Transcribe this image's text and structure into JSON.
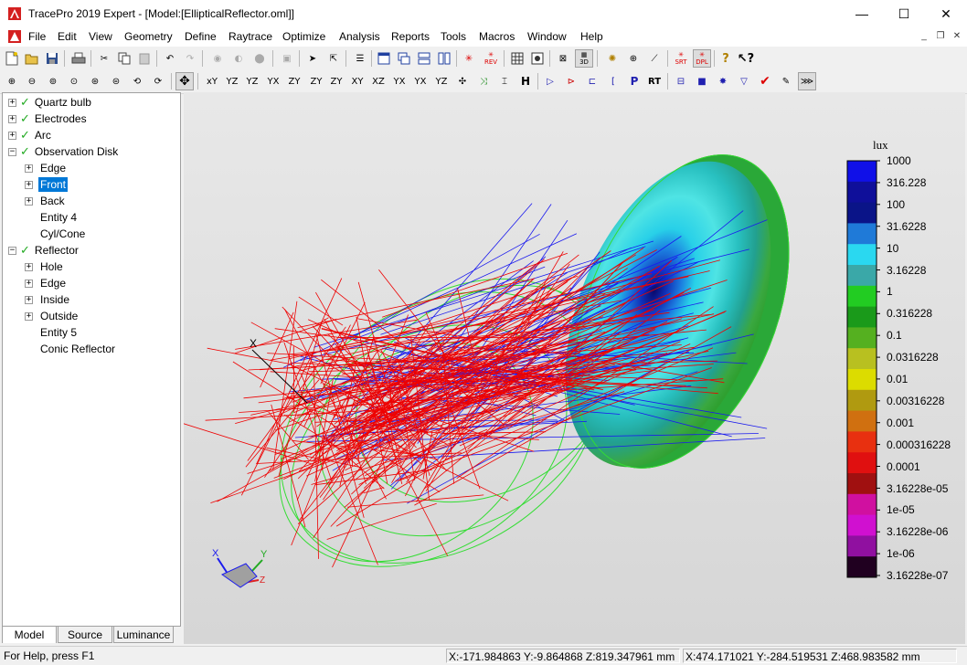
{
  "window": {
    "title": "TracePro 2019 Expert - [Model:[EllipticalReflector.oml]]",
    "minimize": "—",
    "maximize": "☐",
    "close": "✕"
  },
  "menu": [
    "File",
    "Edit",
    "View",
    "Geometry",
    "Define",
    "Raytrace",
    "Optimize",
    "Analysis",
    "Reports",
    "Tools",
    "Macros",
    "Window",
    "Help"
  ],
  "mdi": {
    "minimize": "_",
    "restore": "❐",
    "close": "✕"
  },
  "toolbar1": {
    "srt": "SRT",
    "rev": "REV",
    "dpl": "DPL",
    "mode_3d": "3D"
  },
  "toolbar2": {
    "view_labels": [
      "xY",
      "YZ",
      "YZ",
      "YX",
      "ZY",
      "ZY",
      "ZY",
      "XY",
      "XZ",
      "YX",
      "YX",
      "YZ"
    ],
    "p": "P",
    "rt": "RT",
    "h": "H"
  },
  "tree": [
    {
      "label": "Quartz bulb",
      "level": 0,
      "expander": "+",
      "check": true
    },
    {
      "label": "Electrodes",
      "level": 0,
      "expander": "+",
      "check": true
    },
    {
      "label": "Arc",
      "level": 0,
      "expander": "+",
      "check": true
    },
    {
      "label": "Observation Disk",
      "level": 0,
      "expander": "−",
      "check": true
    },
    {
      "label": "Edge",
      "level": 1,
      "expander": "+",
      "check": false
    },
    {
      "label": "Front",
      "level": 1,
      "expander": "+",
      "check": false,
      "selected": true
    },
    {
      "label": "Back",
      "level": 1,
      "expander": "+",
      "check": false
    },
    {
      "label": "Entity 4",
      "level": 1,
      "expander": "",
      "check": false
    },
    {
      "label": "Cyl/Cone",
      "level": 1,
      "expander": "",
      "check": false
    },
    {
      "label": "Reflector",
      "level": 0,
      "expander": "−",
      "check": true
    },
    {
      "label": "Hole",
      "level": 1,
      "expander": "+",
      "check": false
    },
    {
      "label": "Edge",
      "level": 1,
      "expander": "+",
      "check": false
    },
    {
      "label": "Inside",
      "level": 1,
      "expander": "+",
      "check": false
    },
    {
      "label": "Outside",
      "level": 1,
      "expander": "+",
      "check": false
    },
    {
      "label": "Entity 5",
      "level": 1,
      "expander": "",
      "check": false
    },
    {
      "label": "Conic Reflector",
      "level": 1,
      "expander": "",
      "check": false
    }
  ],
  "tabs": [
    "Model",
    "Source",
    "Luminance"
  ],
  "viewport": {
    "axis_label": "X",
    "triad": {
      "x": "X",
      "y": "Y",
      "z": "Z"
    },
    "legend": {
      "unit": "lux",
      "labels": [
        "1000",
        "316.228",
        "100",
        "31.6228",
        "10",
        "3.16228",
        "1",
        "0.316228",
        "0.1",
        "0.0316228",
        "0.01",
        "0.00316228",
        "0.001",
        "0.000316228",
        "0.0001",
        "3.16228e-05",
        "1e-05",
        "3.16228e-06",
        "1e-06",
        "3.16228e-07"
      ]
    }
  },
  "status": {
    "help": "For Help, press F1",
    "coord1": "X:-171.984863 Y:-9.864868 Z:819.347961 mm",
    "coord2": "X:474.171021 Y:-284.519531 Z:468.983582 mm"
  },
  "colors": {
    "ray_red": "#ee0000",
    "ray_blue": "#1a1aee",
    "ellipse_green": "#33dd33",
    "disk_green": "#33b533",
    "selection": "#0078d7",
    "check_green": "#22aa22"
  }
}
